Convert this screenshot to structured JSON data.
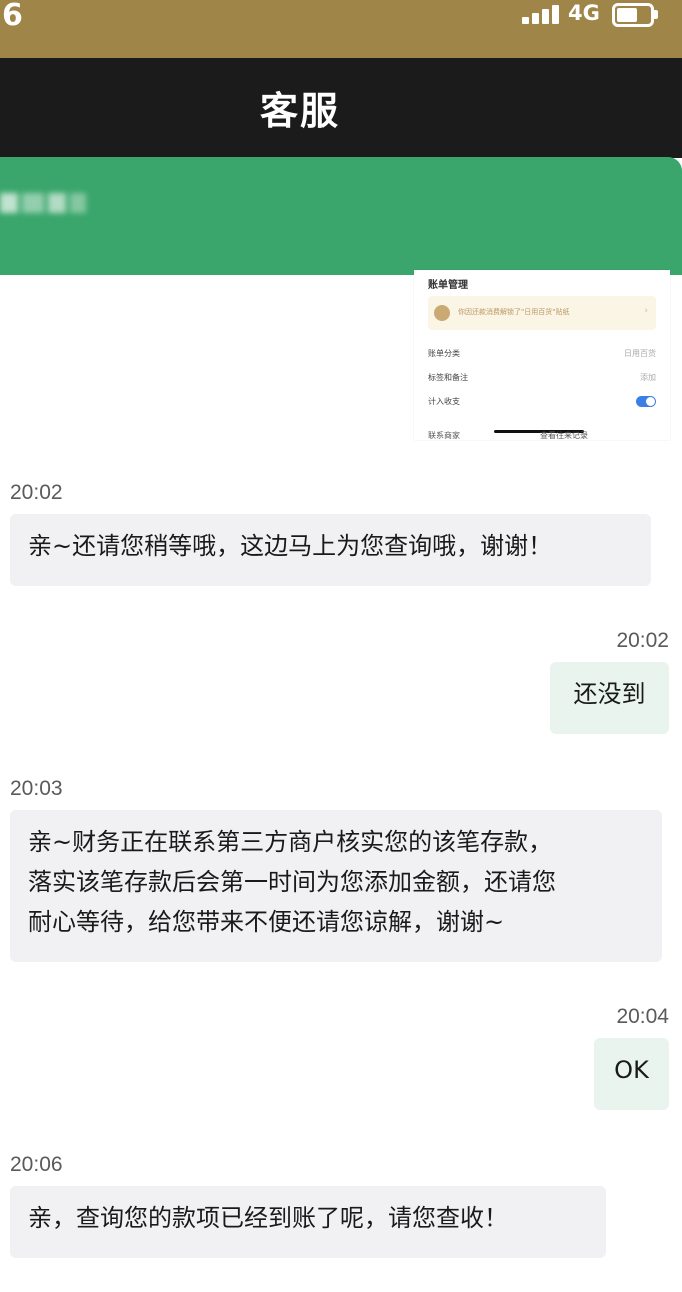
{
  "status_bar": {
    "time": "6",
    "network": "4G"
  },
  "header": {
    "title": "客服"
  },
  "shared_image": {
    "title": "账单管理",
    "notice": "你因还款消费解锁了\"日用百货\"贴纸",
    "rows": [
      {
        "label": "账单分类",
        "value": "日用百货"
      },
      {
        "label": "标签和备注",
        "value": "添加"
      },
      {
        "label": "计入收支",
        "value": ""
      }
    ],
    "footer_left": "联系商家",
    "footer_right": "查看往来记录"
  },
  "messages": [
    {
      "side": "in",
      "time": "20:02",
      "lines": [
        "亲~还请您稍等哦，这边马上为您查询哦，谢谢！"
      ]
    },
    {
      "side": "out",
      "time": "20:02",
      "lines": [
        "还没到"
      ]
    },
    {
      "side": "in",
      "time": "20:03",
      "lines": [
        "亲~财务正在联系第三方商户核实您的该笔存款，",
        "落实该笔存款后会第一时间为您添加金额，还请您",
        "耐心等待，给您带来不便还请您谅解，谢谢~"
      ]
    },
    {
      "side": "out",
      "time": "20:04",
      "lines": [
        "OK"
      ]
    },
    {
      "side": "in",
      "time": "20:06",
      "lines": [
        "亲，查询您的款项已经到账了呢，请您查收！"
      ]
    }
  ],
  "colors": {
    "status_bar": "#9f8547",
    "header": "#1b1b1b",
    "banner": "#3aa66b",
    "incoming_bubble": "#f1f1f3",
    "outgoing_bubble": "#e9f4ef"
  }
}
